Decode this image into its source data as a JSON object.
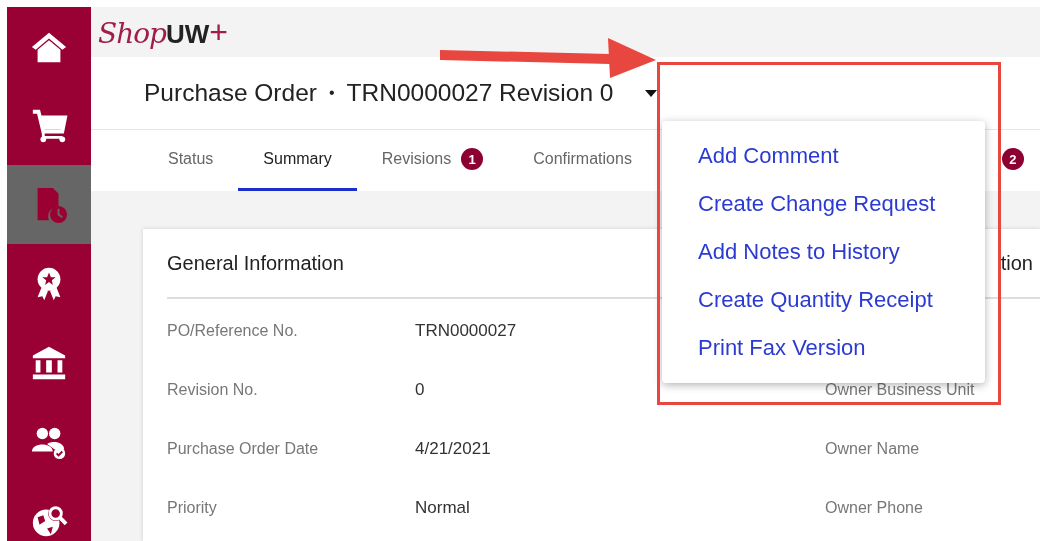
{
  "sidebar": {
    "items": [
      {
        "selected": false
      },
      {
        "selected": false
      },
      {
        "selected": true
      },
      {
        "selected": false
      },
      {
        "selected": false
      },
      {
        "selected": false
      },
      {
        "selected": false
      }
    ]
  },
  "logo": {
    "script": "Shop",
    "bold": "UW",
    "mark": "+"
  },
  "header": {
    "title": "Purchase Order",
    "separator": "•",
    "number": "TRN0000027 Revision 0"
  },
  "tabs": [
    {
      "label": "Status",
      "selected": false
    },
    {
      "label": "Summary",
      "selected": true
    },
    {
      "label": "Revisions",
      "badge": "1",
      "selected": false
    },
    {
      "label": "Confirmations",
      "selected": false
    },
    {
      "badge": "2",
      "selected": false
    }
  ],
  "card": {
    "title": "General Information",
    "column_3_title": "tion",
    "rows": [
      {
        "label": "PO/Reference No.",
        "value": "TRN0000027"
      },
      {
        "label": "Revision No.",
        "value": "0",
        "label_2": "Owner Business Unit"
      },
      {
        "label": "Purchase Order Date",
        "value": "4/21/2021",
        "label_2": "Owner Name"
      },
      {
        "label": "Priority",
        "value": "Normal",
        "label_2": "Owner Phone"
      }
    ]
  },
  "menu": {
    "items": [
      "Add Comment",
      "Create Change Request",
      "Add Notes to History",
      "Create Quantity Receipt",
      "Print Fax Version"
    ]
  }
}
